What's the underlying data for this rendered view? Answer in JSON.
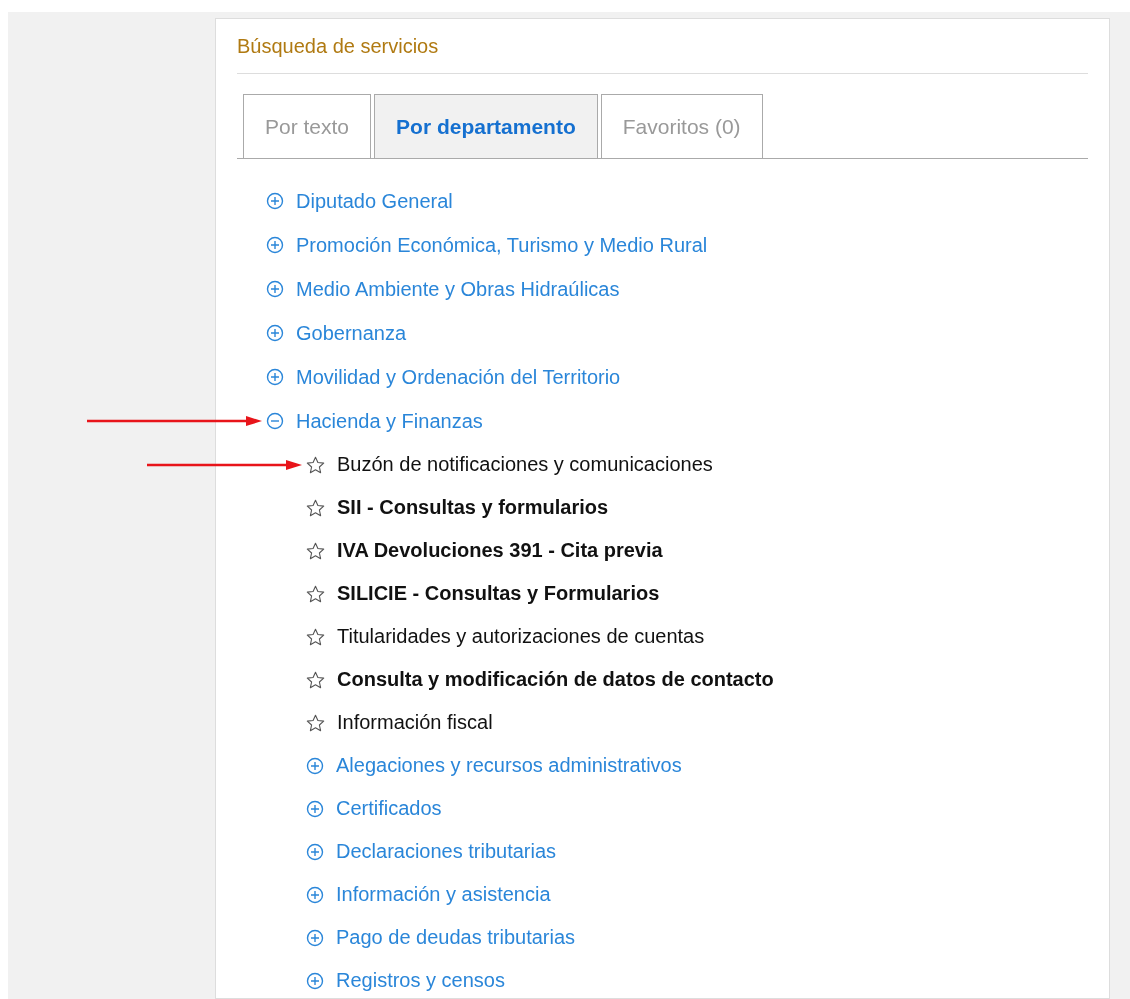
{
  "panel": {
    "title": "Búsqueda de servicios"
  },
  "tabs": [
    {
      "label": "Por texto",
      "selected": false
    },
    {
      "label": "Por departamento",
      "selected": true
    },
    {
      "label": "Favoritos (0)",
      "selected": false
    }
  ],
  "departments": [
    {
      "label": "Diputado General",
      "expanded": false,
      "arrow": false
    },
    {
      "label": "Promoción Económica, Turismo y Medio Rural",
      "expanded": false,
      "arrow": false
    },
    {
      "label": "Medio Ambiente y Obras Hidraúlicas",
      "expanded": false,
      "arrow": false
    },
    {
      "label": "Gobernanza",
      "expanded": false,
      "arrow": false
    },
    {
      "label": "Movilidad y Ordenación del Territorio",
      "expanded": false,
      "arrow": false
    },
    {
      "label": "Hacienda y Finanzas",
      "expanded": true,
      "arrow": true,
      "children": [
        {
          "kind": "service",
          "label": "Buzón de notificaciones y comunicaciones",
          "bold": false,
          "favorite": false,
          "arrow": true
        },
        {
          "kind": "service",
          "label": "SII - Consultas y formularios",
          "bold": true,
          "favorite": false,
          "arrow": false
        },
        {
          "kind": "service",
          "label": "IVA Devoluciones 391 - Cita previa",
          "bold": true,
          "favorite": false,
          "arrow": false
        },
        {
          "kind": "service",
          "label": "SILICIE - Consultas y Formularios",
          "bold": true,
          "favorite": false,
          "arrow": false
        },
        {
          "kind": "service",
          "label": "Titularidades y autorizaciones de cuentas",
          "bold": false,
          "favorite": false,
          "arrow": false
        },
        {
          "kind": "service",
          "label": "Consulta y modificación de datos de contacto",
          "bold": true,
          "favorite": false,
          "arrow": false
        },
        {
          "kind": "service",
          "label": "Información fiscal",
          "bold": false,
          "favorite": false,
          "arrow": false
        },
        {
          "kind": "group",
          "label": "Alegaciones y recursos administrativos",
          "expanded": false,
          "arrow": false
        },
        {
          "kind": "group",
          "label": "Certificados",
          "expanded": false,
          "arrow": false
        },
        {
          "kind": "group",
          "label": "Declaraciones tributarias",
          "expanded": false,
          "arrow": false
        },
        {
          "kind": "group",
          "label": "Información y asistencia",
          "expanded": false,
          "arrow": false
        },
        {
          "kind": "group",
          "label": "Pago de deudas tributarias",
          "expanded": false,
          "arrow": false
        },
        {
          "kind": "group",
          "label": "Registros y censos",
          "expanded": false,
          "arrow": false
        }
      ]
    }
  ]
}
